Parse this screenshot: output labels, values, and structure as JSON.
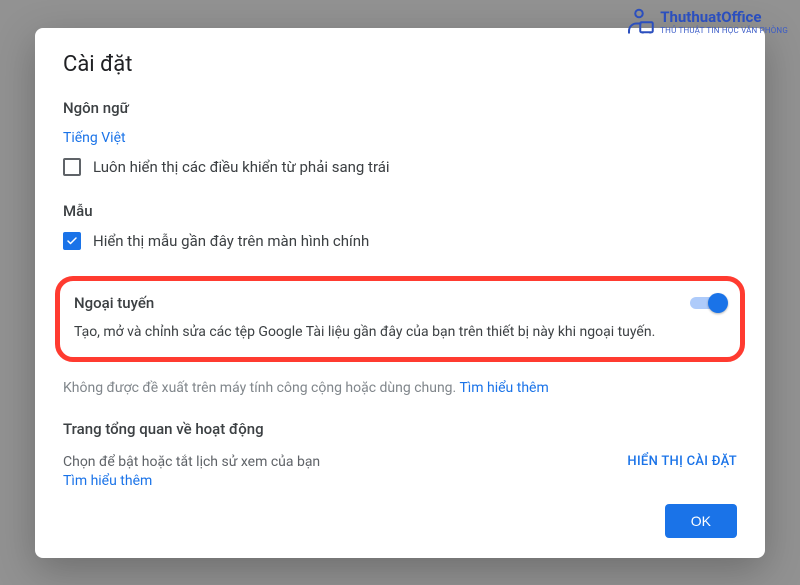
{
  "watermark": {
    "brand": "ThuthuatOffice",
    "tagline": "THỦ THUẬT TIN HỌC VĂN PHÒNG"
  },
  "dialog": {
    "title": "Cài đặt",
    "language": {
      "heading": "Ngôn ngữ",
      "current": "Tiếng Việt",
      "rtl_checkbox_label": "Luôn hiển thị các điều khiển từ phải sang trái",
      "rtl_checked": false
    },
    "templates": {
      "heading": "Mẫu",
      "checkbox_label": "Hiển thị mẫu gần đây trên màn hình chính",
      "checked": true
    },
    "offline": {
      "heading": "Ngoại tuyến",
      "description": "Tạo, mở và chỉnh sửa các tệp Google Tài liệu gần đây của bạn trên thiết bị này khi ngoại tuyến.",
      "toggle_on": true,
      "warning_prefix": "Không được đề xuất trên máy tính công cộng hoặc dùng chung. ",
      "warning_link": "Tìm hiểu thêm"
    },
    "activity": {
      "heading": "Trang tổng quan về hoạt động",
      "description": "Chọn để bật hoặc tắt lịch sử xem của bạn",
      "learn_more": "Tìm hiểu thêm",
      "show_settings": "HIỂN THỊ CÀI ĐẶT"
    },
    "ok_button": "OK"
  }
}
